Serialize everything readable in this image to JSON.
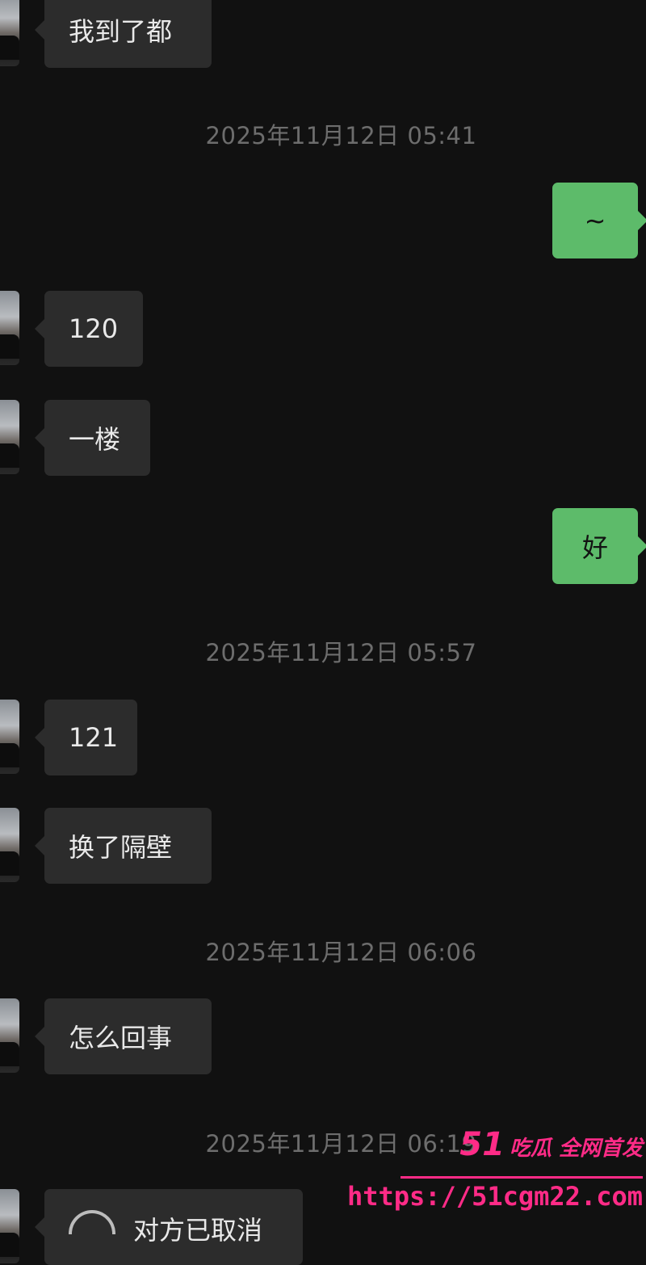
{
  "messages": [
    {
      "side": "in",
      "text": "我到了都"
    },
    {
      "timestamp": "2025年11月12日 05:41"
    },
    {
      "side": "out",
      "text": "~"
    },
    {
      "side": "in",
      "text": "120"
    },
    {
      "side": "in",
      "text": "一楼"
    },
    {
      "side": "out",
      "text": "好"
    },
    {
      "timestamp": "2025年11月12日 05:57"
    },
    {
      "side": "in",
      "text": "121"
    },
    {
      "side": "in",
      "text": "换了隔壁"
    },
    {
      "timestamp": "2025年11月12日 06:06"
    },
    {
      "side": "in",
      "text": "怎么回事"
    },
    {
      "timestamp": "2025年11月12日 06:19"
    },
    {
      "side": "in",
      "text": "对方已取消",
      "icon": "phone-icon"
    }
  ],
  "watermark": {
    "brand": "51",
    "tagline": "吃瓜 全网首发",
    "url": "https://51cgm22.com"
  },
  "colors": {
    "background": "#111111",
    "incoming_bubble": "#2c2c2c",
    "outgoing_bubble": "#5dbb6a",
    "timestamp_text": "#6d6d6d",
    "watermark": "#ff2b87"
  }
}
